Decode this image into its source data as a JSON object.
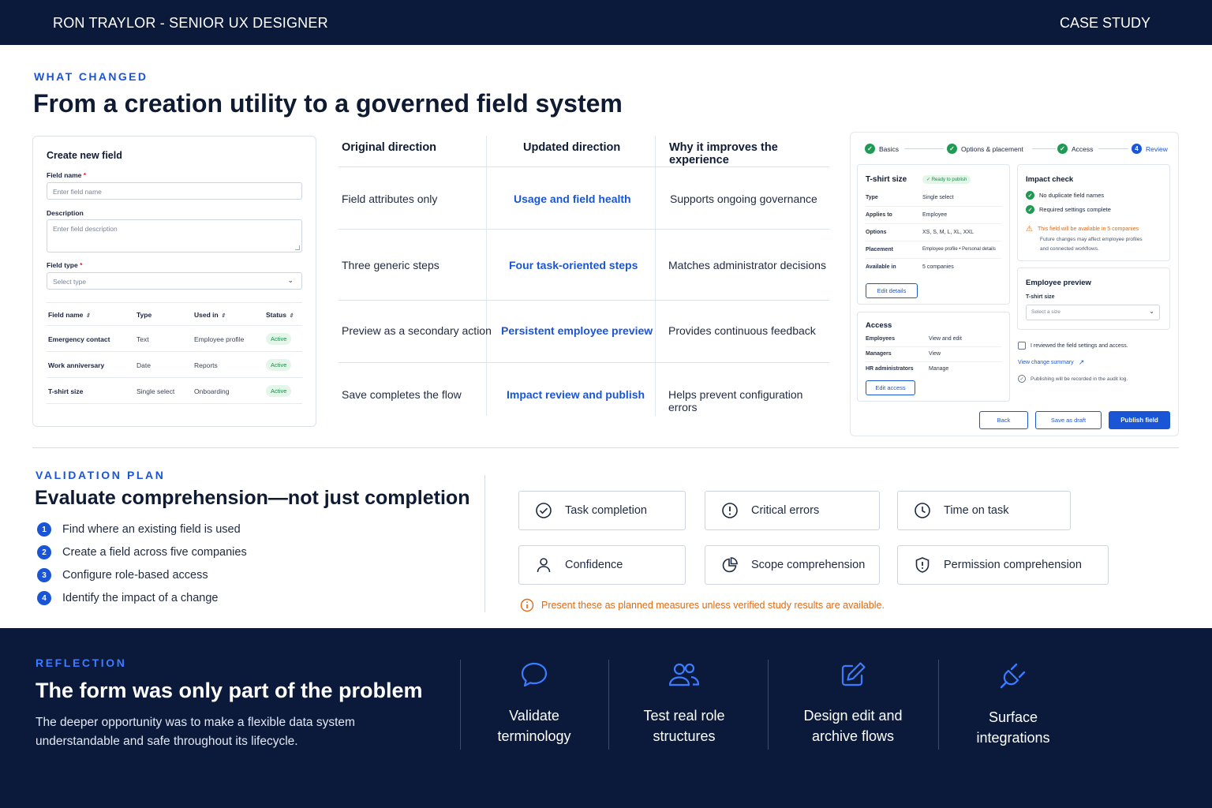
{
  "header": {
    "left": "RON TRAYLOR - SENIOR UX DESIGNER",
    "right": "CASE STUDY"
  },
  "what_changed": {
    "eyebrow": "WHAT CHANGED",
    "title": "From a creation utility to a governed field system"
  },
  "create_form": {
    "title": "Create new field",
    "field_name_label": "Field name",
    "field_name_placeholder": "Enter field name",
    "description_label": "Description",
    "description_placeholder": "Enter field description",
    "field_type_label": "Field type",
    "field_type_placeholder": "Select type",
    "required_mark": "*",
    "table_headers": [
      "Field name",
      "Type",
      "Used in",
      "Status"
    ],
    "rows": [
      {
        "name": "Emergency contact",
        "type": "Text",
        "used_in": "Employee profile",
        "status": "Active"
      },
      {
        "name": "Work anniversary",
        "type": "Date",
        "used_in": "Reports",
        "status": "Active"
      },
      {
        "name": "T-shirt size",
        "type": "Single select",
        "used_in": "Onboarding",
        "status": "Active"
      }
    ]
  },
  "comparison": {
    "headers": [
      "Original direction",
      "Updated direction",
      "Why it improves the experience"
    ],
    "rows": [
      {
        "original": "Field attributes only",
        "updated": "Usage and field health",
        "why": "Supports ongoing governance"
      },
      {
        "original": "Three generic steps",
        "updated": "Four task-oriented steps",
        "why": "Matches administrator decisions"
      },
      {
        "original": "Preview as a secondary action",
        "updated": "Persistent employee preview",
        "why": "Provides continuous feedback"
      },
      {
        "original": "Save completes the flow",
        "updated": "Impact review and publish",
        "why": "Helps prevent configuration errors"
      }
    ]
  },
  "wizard": {
    "steps": [
      {
        "label": "Basics",
        "state": "done"
      },
      {
        "label": "Options & placement",
        "state": "done"
      },
      {
        "label": "Access",
        "state": "done"
      },
      {
        "label": "Review",
        "state": "current",
        "number": "4"
      }
    ],
    "summary": {
      "title": "T-shirt size",
      "badge": "Ready to publish",
      "rows": [
        {
          "k": "Type",
          "v": "Single select"
        },
        {
          "k": "Applies to",
          "v": "Employee"
        },
        {
          "k": "Options",
          "v": "XS, S, M, L, XL, XXL"
        },
        {
          "k": "Placement",
          "v": "Employee profile • Personal details"
        },
        {
          "k": "Available in",
          "v": "5 companies"
        }
      ],
      "edit_button": "Edit details"
    },
    "access": {
      "title": "Access",
      "rows": [
        {
          "k": "Employees",
          "v": "View and edit"
        },
        {
          "k": "Managers",
          "v": "View"
        },
        {
          "k": "HR administrators",
          "v": "Manage"
        }
      ],
      "edit_button": "Edit access"
    },
    "impact": {
      "title": "Impact check",
      "checks": [
        "No duplicate field names",
        "Required settings complete"
      ],
      "warning_title": "This field will be available in 5 companies",
      "warning_body_1": "Future changes may affect employee profiles",
      "warning_body_2": "and connected workflows."
    },
    "preview": {
      "title": "Employee preview",
      "field_label": "T-shirt size",
      "placeholder": "Select a size"
    },
    "confirm_label": "I reviewed the field settings and access.",
    "change_summary_link": "View change summary",
    "audit_note": "Publishing will be recorded in the audit log.",
    "buttons": {
      "back": "Back",
      "draft": "Save as draft",
      "publish": "Publish field"
    }
  },
  "validation": {
    "eyebrow": "VALIDATION PLAN",
    "title": "Evaluate comprehension—not just completion",
    "tasks": [
      {
        "n": "1",
        "text": "Find where an existing field is used"
      },
      {
        "n": "2",
        "text": "Create a field across five companies"
      },
      {
        "n": "3",
        "text": "Configure role-based access"
      },
      {
        "n": "4",
        "text": "Identify the impact of a change"
      }
    ],
    "metrics": [
      {
        "label": "Task completion",
        "icon": "check-circle-icon"
      },
      {
        "label": "Critical errors",
        "icon": "alert-circle-icon"
      },
      {
        "label": "Time on task",
        "icon": "clock-icon"
      },
      {
        "label": "Confidence",
        "icon": "person-icon"
      },
      {
        "label": "Scope comprehension",
        "icon": "pie-chart-icon"
      },
      {
        "label": "Permission comprehension",
        "icon": "shield-icon"
      }
    ],
    "note": "Present these as planned measures unless verified study results are available."
  },
  "reflection": {
    "eyebrow": "REFLECTION",
    "title": "The form was only part of the problem",
    "body": "The deeper opportunity was to make a flexible data system understandable and safe throughout its lifecycle.",
    "items": [
      {
        "line1": "Validate",
        "line2": "terminology",
        "icon": "chat-bubble-icon"
      },
      {
        "line1": "Test real role",
        "line2": "structures",
        "icon": "users-icon"
      },
      {
        "line1": "Design edit and",
        "line2": "archive flows",
        "icon": "edit-icon"
      },
      {
        "line1": "Surface",
        "line2": "integrations",
        "icon": "plug-icon"
      }
    ]
  },
  "colors": {
    "navy": "#0b1a3a",
    "accent": "#1a55d6",
    "success": "#1f9a55",
    "warning": "#e06a15"
  }
}
